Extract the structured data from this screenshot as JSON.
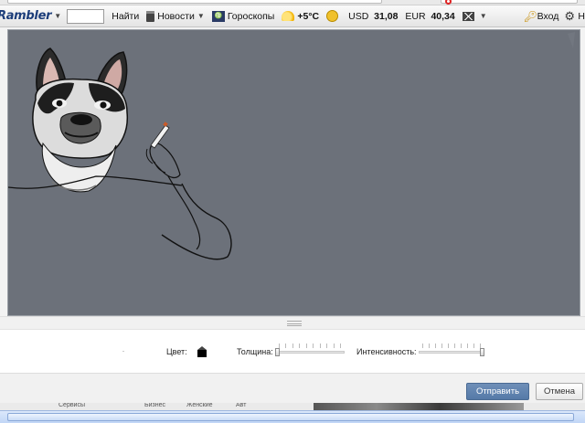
{
  "toolbar": {
    "logo": "Rambler",
    "find_label": "Найти",
    "news_label": "Новости",
    "horoscope_label": "Гороскопы",
    "weather_temp": "+5°C",
    "usd_label": "USD",
    "usd_value": "31,08",
    "eur_label": "EUR",
    "eur_value": "40,34",
    "login_label": "Вход",
    "icons": [
      "news-icon",
      "horoscope-icon",
      "weather-icon",
      "smiley-icon",
      "mail-icon",
      "key-icon",
      "gear-icon"
    ]
  },
  "canvas": {
    "background": "#6c717a"
  },
  "controls": {
    "color_label": "Цвет:",
    "color_value": "#000000",
    "thickness_label": "Толщина:",
    "thickness_level": 0,
    "intensity_label": "Интенсивность:",
    "intensity_level": 1
  },
  "footer": {
    "send_label": "Отправить",
    "cancel_label": "Отмена"
  },
  "below": {
    "links": [
      "Сервисы",
      "Бизнес",
      "Женские",
      "Авт"
    ]
  }
}
